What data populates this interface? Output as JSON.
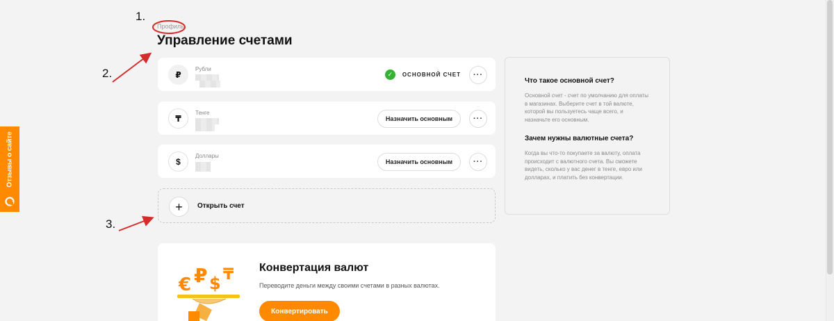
{
  "feedback": {
    "label": "Отзывы о сайте"
  },
  "annotations": {
    "n1": "1.",
    "n2": "2.",
    "n3": "3."
  },
  "breadcrumb": "Профиль",
  "title": "Управление счетами",
  "accounts": [
    {
      "symbol": "₽",
      "name": "Рубли",
      "is_main": true,
      "main_label": "ОСНОВНОЙ СЧЕТ"
    },
    {
      "symbol": "₸",
      "name": "Тенге",
      "is_main": false,
      "action_label": "Назначить основным"
    },
    {
      "symbol": "$",
      "name": "Доллары",
      "is_main": false,
      "action_label": "Назначить основным"
    }
  ],
  "more_glyph": "···",
  "open_account": {
    "plus": "+",
    "label": "Открыть счет"
  },
  "info": {
    "q1": "Что такое основной счет?",
    "a1": "Основной счет - счет по умолчанию для оплаты в магазинах. Выберите счет в той валюте, которой вы пользуетесь чаще всего, и назначьте его основным.",
    "q2": "Зачем нужны валютные счета?",
    "a2": "Когда вы что-то покупаете за валюту, оплата происходит с валютного счета. Вы сможете видеть, сколько у вас денег в тенге, евро или долларах, и платить без конвертации."
  },
  "conversion": {
    "title": "Конвертация валют",
    "subtitle": "Переводите деньги между своими счетами в разных валютах.",
    "button": "Конвертировать",
    "symbols": [
      "€",
      "₽",
      "$",
      "₸"
    ]
  },
  "colors": {
    "accent": "#ff8a00",
    "success": "#34b233",
    "annotation": "#d62b2b"
  }
}
